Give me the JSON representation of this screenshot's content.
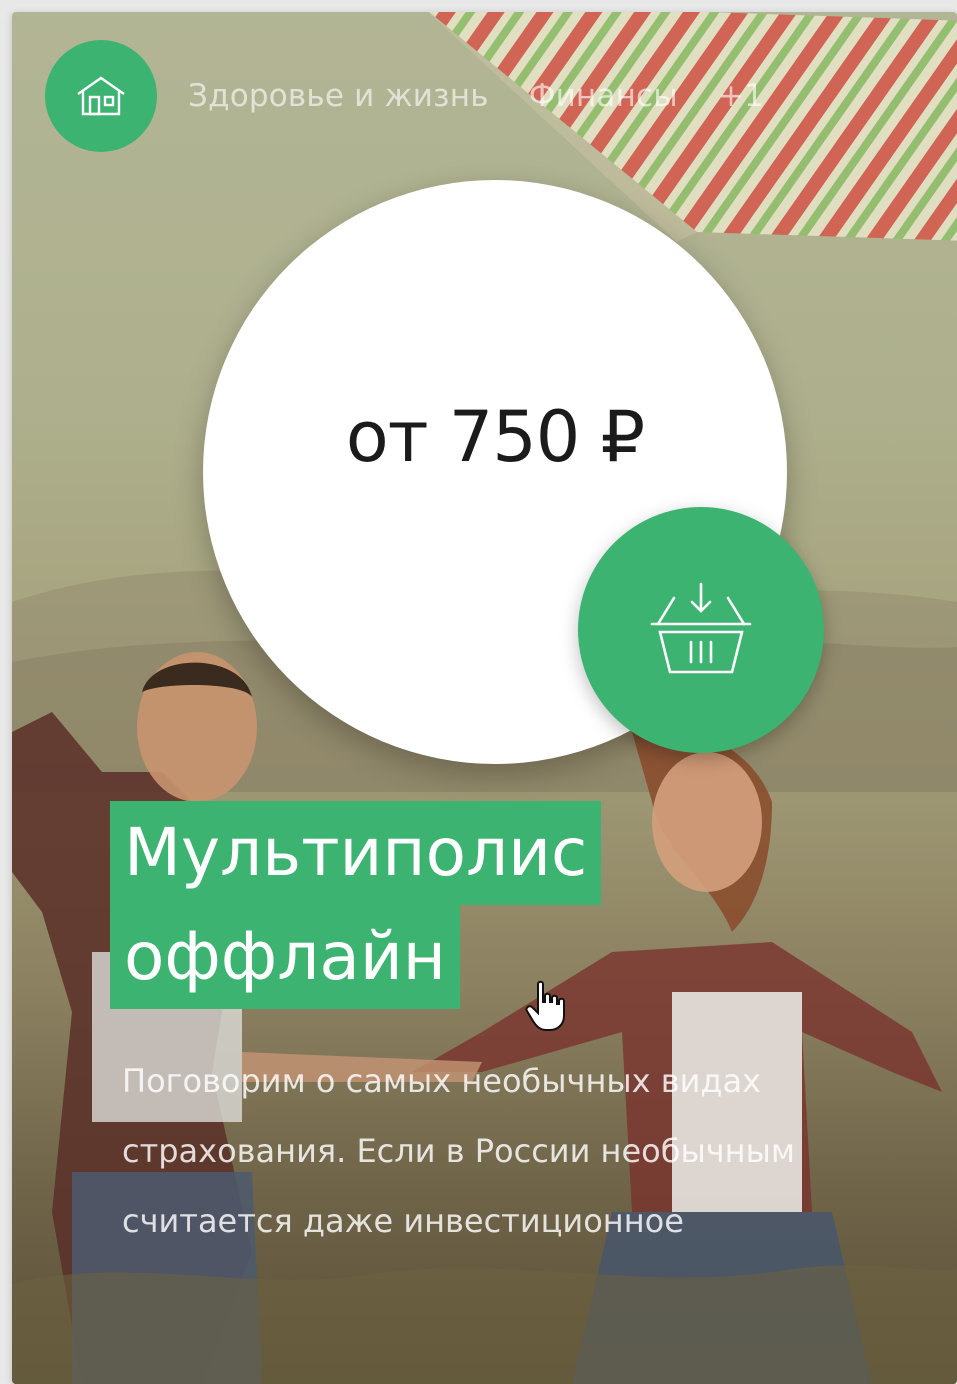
{
  "nav": {
    "home_icon": "house-icon",
    "items": [
      {
        "label": "Здоровье и жизнь"
      },
      {
        "label": "Финансы"
      },
      {
        "label": "+1"
      }
    ]
  },
  "price": {
    "text": "от 750 ₽"
  },
  "cart": {
    "icon": "basket-download-icon"
  },
  "title": {
    "line1": "Мультиполис",
    "line2": "оффлайн"
  },
  "description": "Поговорим о самых необычных видах страхования. Если в России необычным считается даже инвестиционное",
  "colors": {
    "accent": "#3cb371",
    "price_bg": "#ffffff",
    "text_light": "#ffffff"
  }
}
